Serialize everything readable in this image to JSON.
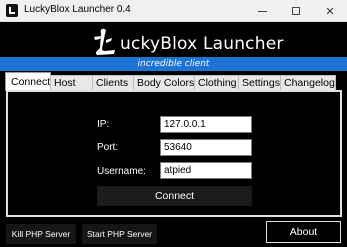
{
  "window": {
    "title": "LuckyBlox Launcher 0.4",
    "close_glyph": "✕"
  },
  "header": {
    "logo_text": "uckyBlox Launcher",
    "banner": "incredible client",
    "banner_color": "#1e73d6"
  },
  "tabs": [
    {
      "label": "Connect",
      "active": true
    },
    {
      "label": "Host"
    },
    {
      "label": "Clients"
    },
    {
      "label": "Body Colors"
    },
    {
      "label": "Clothing"
    },
    {
      "label": "Settings"
    },
    {
      "label": "Changelog"
    }
  ],
  "connect": {
    "ip_label": "IP:",
    "ip_value": "127.0.0.1",
    "port_label": "Port:",
    "port_value": "53640",
    "username_label": "Username:",
    "username_value": "atpied",
    "connect_label": "Connect"
  },
  "footer": {
    "kill_label": "Kill PHP Server",
    "start_label": "Start PHP Server",
    "about_label": "About"
  }
}
